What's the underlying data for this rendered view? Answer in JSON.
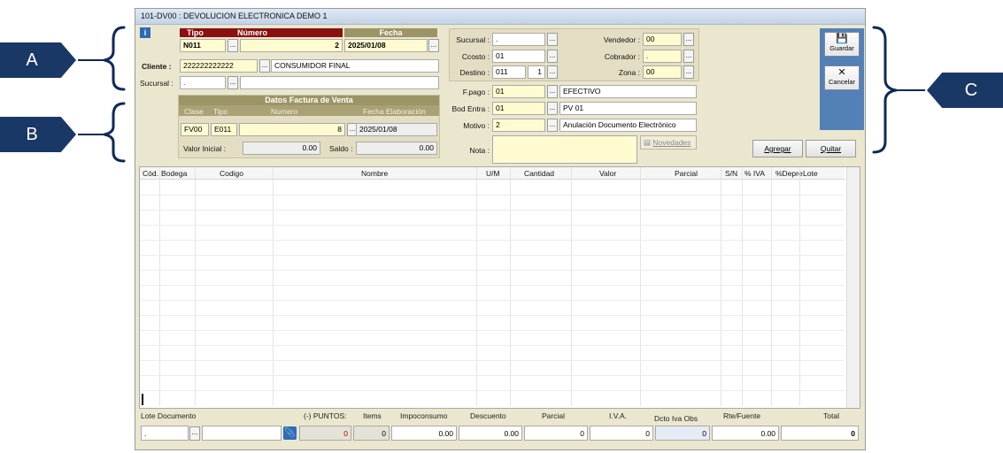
{
  "window": {
    "title": "101-DV00 : DEVOLUCION ELECTRONICA DEMO 1"
  },
  "callouts": {
    "a": "A",
    "b": "B",
    "c": "C"
  },
  "header": {
    "tipo_label": "Tipo",
    "numero_label": "Número",
    "fecha_label": "Fecha",
    "tipo_value": "N011",
    "numero_value": "2",
    "fecha_value": "2025/01/08",
    "cliente_label": "Cliente :",
    "cliente_id": "222222222222",
    "cliente_name": "CONSUMIDOR FINAL",
    "sucursal_label": "Sucursal :",
    "sucursal_value": "."
  },
  "factura": {
    "title": "Datos Factura de Venta",
    "clase_label": "Clase",
    "tipo_label": "Tipo",
    "numero_label": "Numero",
    "fecha_label": "Fecha Elaboración",
    "clase_value": "FV00",
    "tipo_value": "E011",
    "numero_value": "8",
    "fecha_value": "2025/01/08",
    "valor_inicial_label": "Valor Inicial :",
    "valor_inicial_value": "0.00",
    "saldo_label": "Saldo :",
    "saldo_value": "0.00"
  },
  "mid": {
    "sucursal_label": "Sucursal :",
    "sucursal_value": ".",
    "ccosto_label": "Ccosto :",
    "ccosto_value": "01",
    "destino_label": "Destino :",
    "destino_value": "011",
    "destino_num": "1",
    "vendedor_label": "Vendedor :",
    "vendedor_value": "00",
    "cobrador_label": "Cobrador :",
    "cobrador_value": ".",
    "zona_label": "Zona :",
    "zona_value": "00",
    "fpago_label": "F.pago :",
    "fpago_value": "01",
    "fpago_desc": "EFECTIVO",
    "bodentra_label": "Bod Entra :",
    "bodentra_value": "01",
    "bodentra_desc": "PV 01",
    "motivo_label": "Motivo :",
    "motivo_value": "2",
    "motivo_desc": "Anulación Documento Electrónico",
    "nota_label": "Nota :",
    "nota_value": "",
    "novedades_label": "Novedades"
  },
  "toolbar": {
    "guardar_label": "Guardar",
    "cancelar_label": "Cancelar",
    "agregar_label": "Agregar",
    "quitar_label": "Quitar"
  },
  "grid": {
    "columns": [
      "Cód.",
      "Bodega",
      "Codigo",
      "Nombre",
      "U/M",
      "Cantidad",
      "Valor",
      "Parcial",
      "S/N",
      "% IVA",
      "%Depre",
      "Lote"
    ],
    "rows": []
  },
  "footer": {
    "lote_label": "Lote Documento",
    "lote_value": ".",
    "puntos_label": "(-) PUNTOS:",
    "puntos_value": "0",
    "items_label": "Items",
    "items_value": "0",
    "impoconsumo_label": "Impoconsumo",
    "impoconsumo_value": "0.00",
    "descuento_label": "Descuento",
    "descuento_value": "0.00",
    "parcial_label": "Parcial",
    "parcial_value": "0",
    "iva_label": "I.V.A.",
    "iva_value": "0",
    "dcto_label": "Dcto Iva Obs",
    "dcto_value": "0",
    "rte_label": "Rte/Fuente",
    "rte_value": "0.00",
    "total_label": "Total",
    "total_value": "0"
  },
  "colors": {
    "callout": "#1a3866",
    "window": "#ebe7cf",
    "toolbar": "#5480b8",
    "header_red": "#8b1010"
  }
}
